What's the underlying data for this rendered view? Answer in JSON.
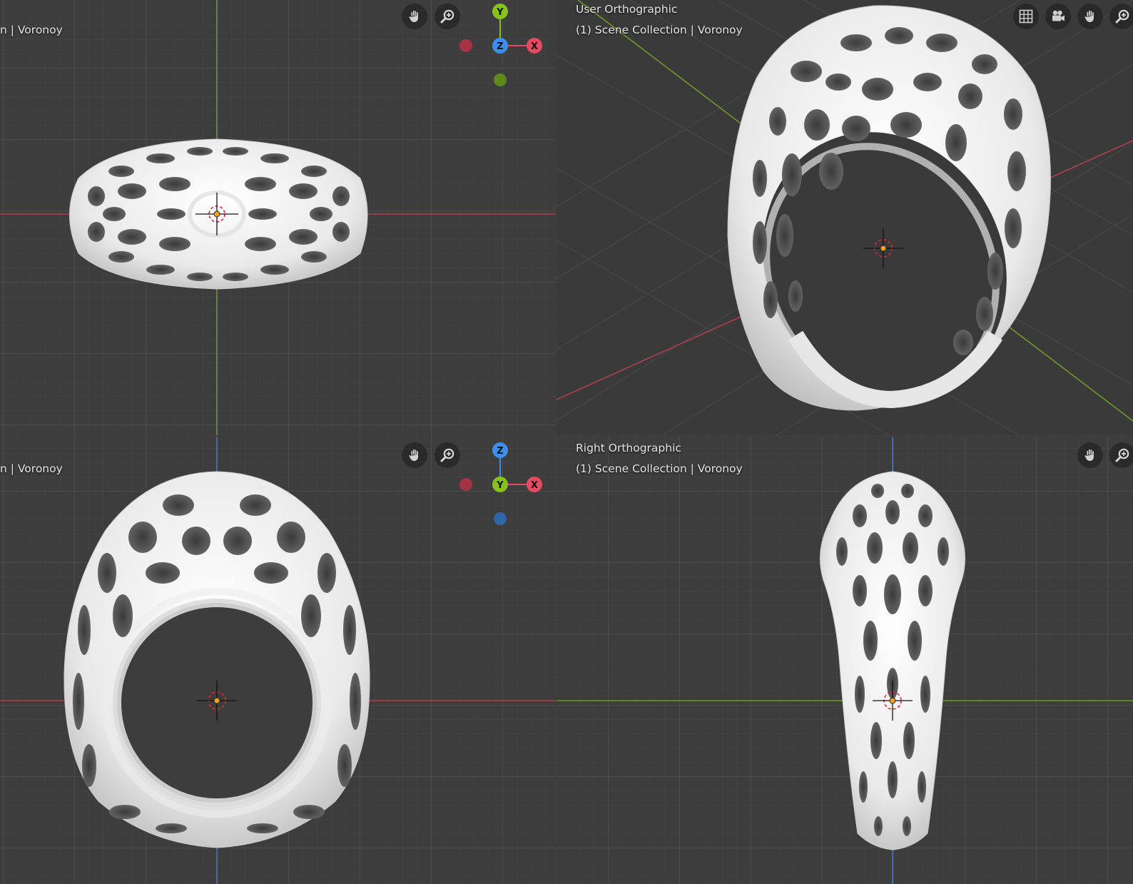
{
  "viewports": {
    "top_left": {
      "label_line2": "n | Voronoy",
      "gizmo": {
        "top": "Y",
        "center": "Z",
        "right": "X"
      }
    },
    "top_right": {
      "label_line1": "User Orthographic",
      "label_line2": "(1) Scene Collection | Voronoy"
    },
    "bottom_left": {
      "label_line2": "n | Voronoy",
      "gizmo": {
        "top": "Z",
        "center": "Y",
        "right": "X"
      }
    },
    "bottom_right": {
      "label_line1": "Right Orthographic",
      "label_line2": "(1) Scene Collection | Voronoy"
    }
  },
  "icons": {
    "pan": "hand-icon",
    "zoom": "magnifier-plus-icon",
    "grid": "grid-icon",
    "camera": "camera-icon",
    "cursor": "3d-cursor-icon"
  },
  "colors": {
    "axis_x": "#e54a5e",
    "axis_y": "#86c31a",
    "axis_z": "#3b8ff0",
    "viewport_bg": "#3d3d3d",
    "mesh": "#efefef"
  }
}
